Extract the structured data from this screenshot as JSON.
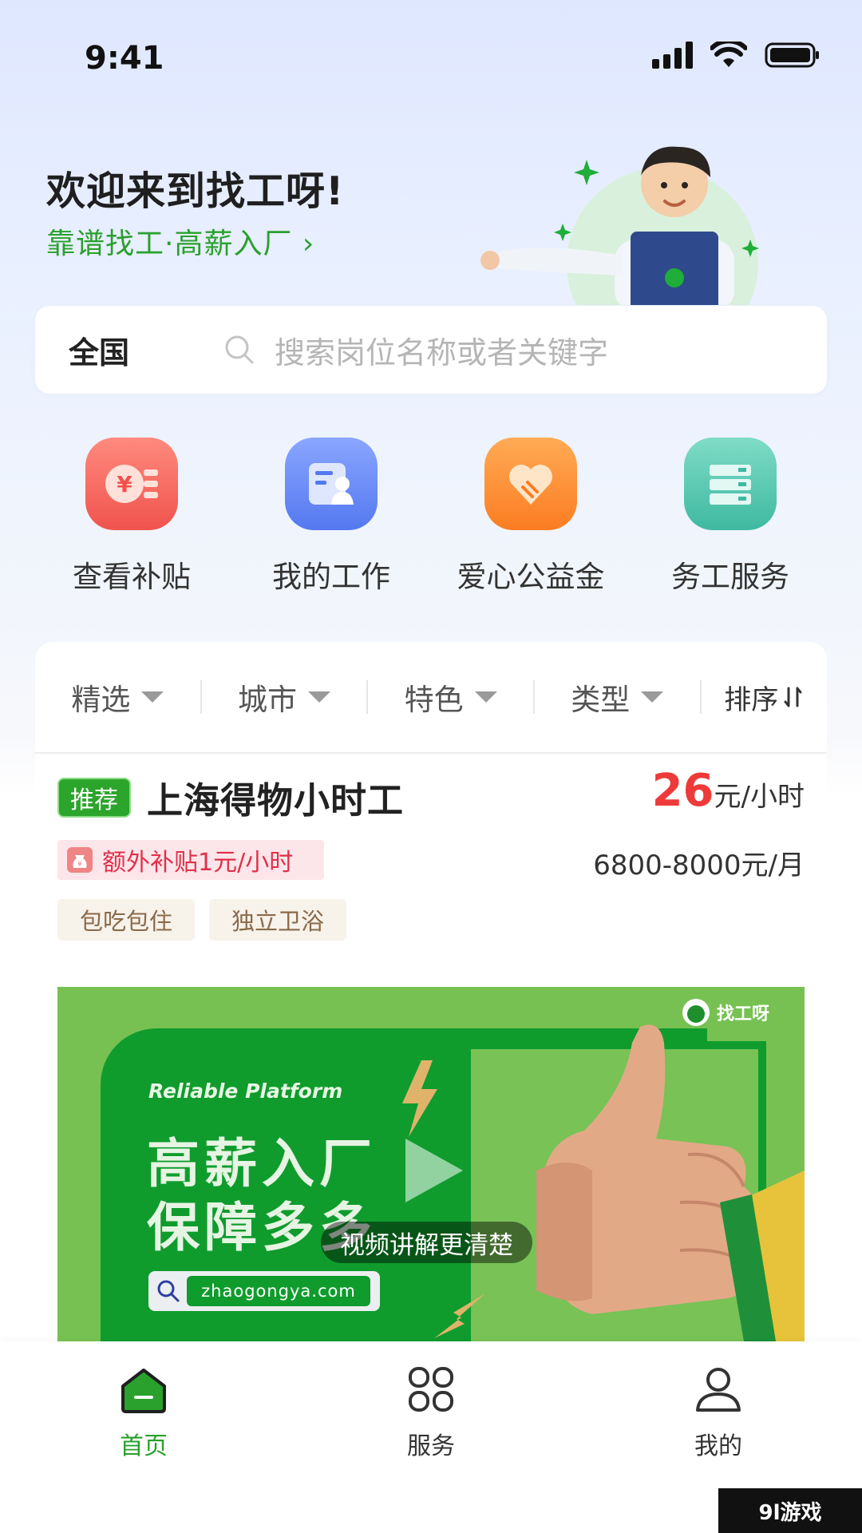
{
  "status": {
    "time": "9:41"
  },
  "header": {
    "welcome": "欢迎来到找工呀!",
    "slogan": "靠谱找工·高薪入厂 ›"
  },
  "search": {
    "region": "全国",
    "placeholder": "搜索岗位名称或者关键字"
  },
  "quick_menu": [
    {
      "label": "查看补贴",
      "icon": "coin-subsidy-icon",
      "color": "#f4645f"
    },
    {
      "label": "我的工作",
      "icon": "work-profile-icon",
      "color": "#6d8cf7"
    },
    {
      "label": "爱心公益金",
      "icon": "heart-hands-icon",
      "color": "#fb8c2e"
    },
    {
      "label": "务工服务",
      "icon": "server-service-icon",
      "color": "#4fc3ad"
    }
  ],
  "filters": {
    "items": [
      "精选",
      "城市",
      "特色",
      "类型"
    ],
    "sort": "排序"
  },
  "job": {
    "tag": "推荐",
    "title": "上海得物小时工",
    "pay_num": "26",
    "pay_unit": "元/小时",
    "subsidy": "额外补贴1元/小时",
    "monthly": "6800-8000元/月",
    "benefits": [
      "包吃包住",
      "独立卫浴"
    ]
  },
  "video": {
    "reliable": "Reliable Platform",
    "line1": "高薪入厂",
    "line2": "保障多多",
    "domain": "zhaogongya.com",
    "caption": "视频讲解更清楚",
    "brand": "找工呀"
  },
  "tabs": [
    {
      "label": "首页",
      "active": true
    },
    {
      "label": "服务",
      "active": false
    },
    {
      "label": "我的",
      "active": false
    }
  ],
  "watermark": "9l游戏",
  "colors": {
    "brand_green": "#2aa02d",
    "price_red": "#ef3a3a"
  }
}
